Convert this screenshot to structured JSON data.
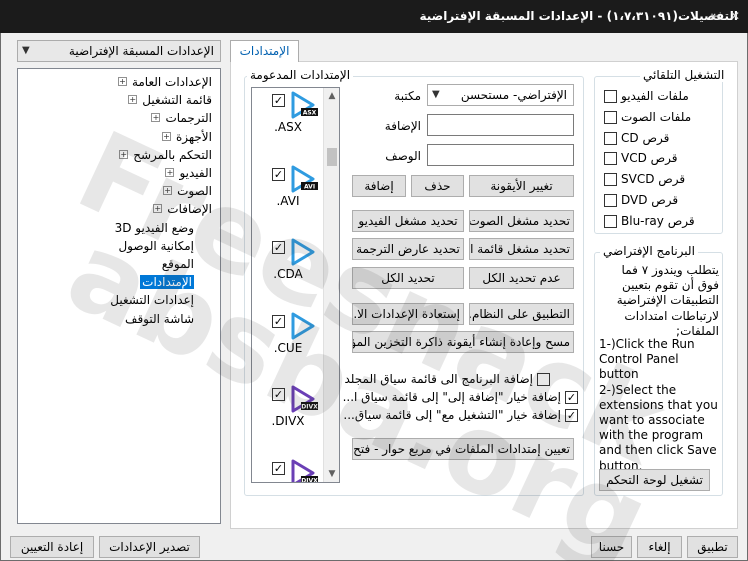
{
  "window": {
    "title": "التفصيلات(١،٧،٣١٠٩١) - الإعدادات المسبقة الإفتراضية",
    "controls": {
      "pin_icon": "pin-icon",
      "close_icon": "close-icon"
    }
  },
  "preset_select": {
    "value": "الإعدادات المسبقة الإفتراضية"
  },
  "tree": {
    "items": [
      {
        "label": "الإعدادات العامة",
        "expandable": true
      },
      {
        "label": "قائمة التشغيل",
        "expandable": true
      },
      {
        "label": "الترجمات",
        "expandable": true
      },
      {
        "label": "الأجهزة",
        "expandable": true
      },
      {
        "label": "التحكم بالمرشح",
        "expandable": true
      },
      {
        "label": "الفيديو",
        "expandable": true
      },
      {
        "label": "الصوت",
        "expandable": true
      },
      {
        "label": "الإضافات",
        "expandable": true
      },
      {
        "label": "وضع الفيديو 3D",
        "expandable": false
      },
      {
        "label": "إمكانية الوصول",
        "expandable": false
      },
      {
        "label": "الموقع",
        "expandable": false
      },
      {
        "label": "الإمتدادات",
        "expandable": false,
        "selected": true
      },
      {
        "label": "إعدادات التشغيل",
        "expandable": false
      },
      {
        "label": "شاشة التوقف",
        "expandable": false
      }
    ]
  },
  "tab": {
    "label": "الإمتدادات"
  },
  "extensions": {
    "group_label": "الإمتدادات المدعومة",
    "items": [
      {
        "ext": ".ASX",
        "badge": "ASX",
        "checked": true
      },
      {
        "ext": ".AVI",
        "badge": "AVI",
        "checked": true
      },
      {
        "ext": ".CDA",
        "badge": "",
        "checked": true
      },
      {
        "ext": ".CUE",
        "badge": "",
        "checked": true
      },
      {
        "ext": ".DIVX",
        "badge": "DIVX",
        "checked": true
      },
      {
        "ext": "",
        "badge": "DIVX",
        "checked": true
      }
    ]
  },
  "form": {
    "library_label": "مكتبة",
    "library_value": "الإفتراضي- مستحسن",
    "add_label": "الإضافة",
    "desc_label": "الوصف",
    "change_icon": "تغيير الأيقونة",
    "delete": "حذف",
    "add": "إضافة",
    "sel_audio_player": "تحديد مشغل الصوت",
    "sel_video_player": "تحديد مشغل الفيديو",
    "sel_playlist": "تحديد مشغل قائمة ا...",
    "sel_sub_viewer": "تحديد عارض الترجمة",
    "deselect_all": "عدم تحديد الكل",
    "select_all": "تحديد الكل",
    "apply_system": "التطبيق على النظام...",
    "restore": "إستعادة الإعدادات الا...",
    "clear_cache": "مسح وإعادة إنشاء أيقونة ذاكرة التخزين المؤ...",
    "cb_add_folder": "إضافة البرنامج الى قائمة سياق المجلد",
    "cb_add_to": "إضافة خيار \"إضافة إلى\" إلى قائمة سياق ا...",
    "cb_play_with": "إضافة خيار \"التشغيل مع\" إلى قائمة سياق...",
    "cb_states": {
      "add_folder": false,
      "add_to": true,
      "play_with": true
    },
    "assign_btn": "تعيين إمتدادات الملفات في مربع حوار - فتح..."
  },
  "autoplay": {
    "group_label": "التشغيل التلقائي",
    "items": [
      {
        "label": "ملفات الفيديو",
        "checked": false
      },
      {
        "label": "ملفات الصوت",
        "checked": false
      },
      {
        "label": "قرص CD",
        "checked": false
      },
      {
        "label": "قرص VCD",
        "checked": false
      },
      {
        "label": "قرص SVCD",
        "checked": false
      },
      {
        "label": "قرص DVD",
        "checked": false
      },
      {
        "label": "قرص Blu-ray",
        "checked": false
      }
    ]
  },
  "default_program": {
    "group_label": "البرنامج الإفتراضي",
    "arabic_text": "يتطلب ويندوز ٧ فما فوق أن تقوم بتعيين التطبيقات الإفتراضية لارتباطات امتدادات الملفات;",
    "english_text": "1-)Click the Run Control Panel button\n2-)Select the extensions that you want to associate with the program and then click Save button.",
    "run_cp_button": "تشغيل لوحة التحكم"
  },
  "bottom": {
    "reset": "إعادة التعيين",
    "export": "تصدير الإعدادات",
    "ok": "حسنا",
    "cancel": "إلغاء",
    "apply": "تطبيق"
  },
  "watermark": {
    "line1": "Freesnack",
    "line2": "absba.org"
  },
  "colors": {
    "selection": "#0078d7",
    "titlebar": "#1b1b1b",
    "icon_blue": "#2f9be0",
    "icon_purple": "#6a3fb5"
  }
}
